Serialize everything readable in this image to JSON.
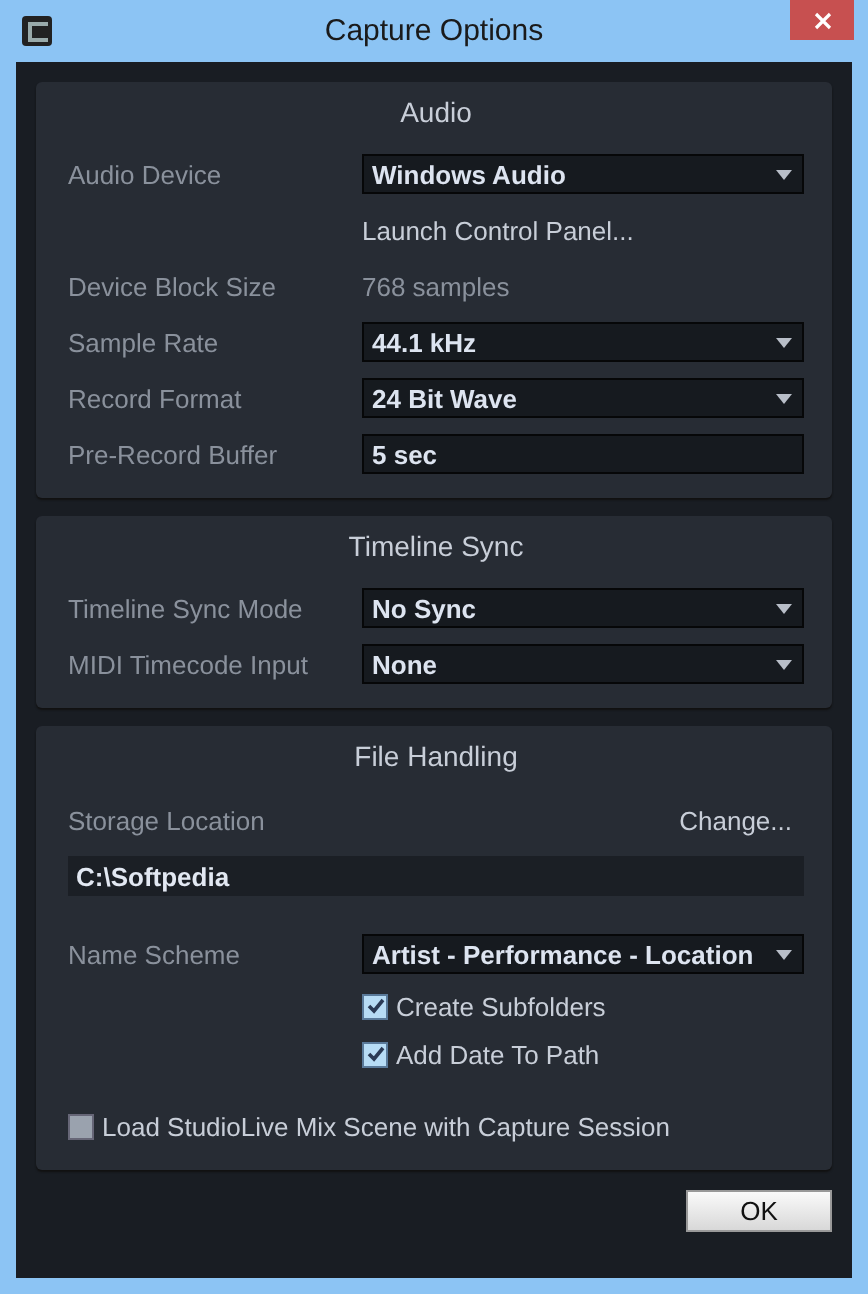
{
  "window": {
    "title": "Capture Options"
  },
  "sections": [
    {
      "title": "Audio",
      "rows": [
        {
          "kind": "dropdown",
          "label": "Audio Device",
          "value": "Windows Audio"
        },
        {
          "kind": "action",
          "value": "Launch Control Panel..."
        },
        {
          "kind": "info",
          "label": "Device Block Size",
          "value": "768 samples"
        },
        {
          "kind": "dropdown",
          "label": "Sample Rate",
          "value": "44.1 kHz"
        },
        {
          "kind": "dropdown",
          "label": "Record Format",
          "value": "24 Bit Wave"
        },
        {
          "kind": "field",
          "label": "Pre-Record Buffer",
          "value": "5 sec"
        }
      ]
    },
    {
      "title": "Timeline Sync",
      "rows": [
        {
          "kind": "dropdown",
          "label": "Timeline Sync Mode",
          "value": "No Sync"
        },
        {
          "kind": "dropdown",
          "label": "MIDI Timecode Input",
          "value": "None"
        }
      ]
    },
    {
      "title": "File Handling",
      "rows": [
        {
          "kind": "storage",
          "label": "Storage Location",
          "value": "Change..."
        },
        {
          "kind": "path",
          "value": "C:\\Softpedia"
        },
        {
          "kind": "dropdown",
          "label": "Name Scheme",
          "value": "Artist - Performance - Location"
        },
        {
          "kind": "checkbox",
          "label": "Create Subfolders",
          "checked": true
        },
        {
          "kind": "checkbox",
          "label": "Add Date To Path",
          "checked": true
        },
        {
          "kind": "option",
          "label": "Load StudioLive Mix Scene with Capture Session",
          "checked": false
        }
      ]
    }
  ],
  "buttons": [
    "OK"
  ]
}
